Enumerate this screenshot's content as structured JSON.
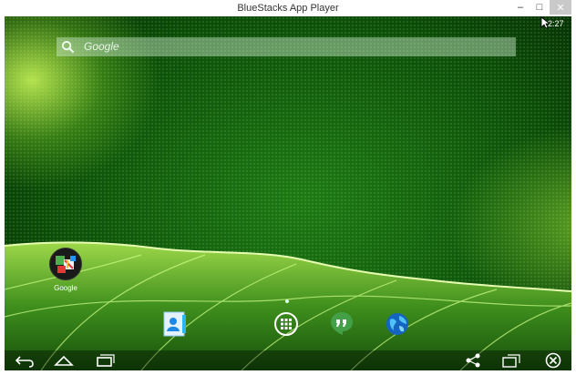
{
  "window": {
    "title": "BlueStacks App Player",
    "min_glyph": "‒",
    "max_glyph": "□",
    "close_glyph": "✕"
  },
  "status": {
    "time": "2:27"
  },
  "search": {
    "label": "Google"
  },
  "apps": [
    {
      "label": "Google",
      "icon": "google-folder-icon"
    }
  ],
  "dock": [
    "contacts-icon",
    "app-drawer-icon",
    "hangouts-icon",
    "browser-icon"
  ],
  "nav": [
    "back-icon",
    "home-icon",
    "recents-icon",
    "share-icon",
    "screen-icon",
    "close-circle-icon"
  ]
}
